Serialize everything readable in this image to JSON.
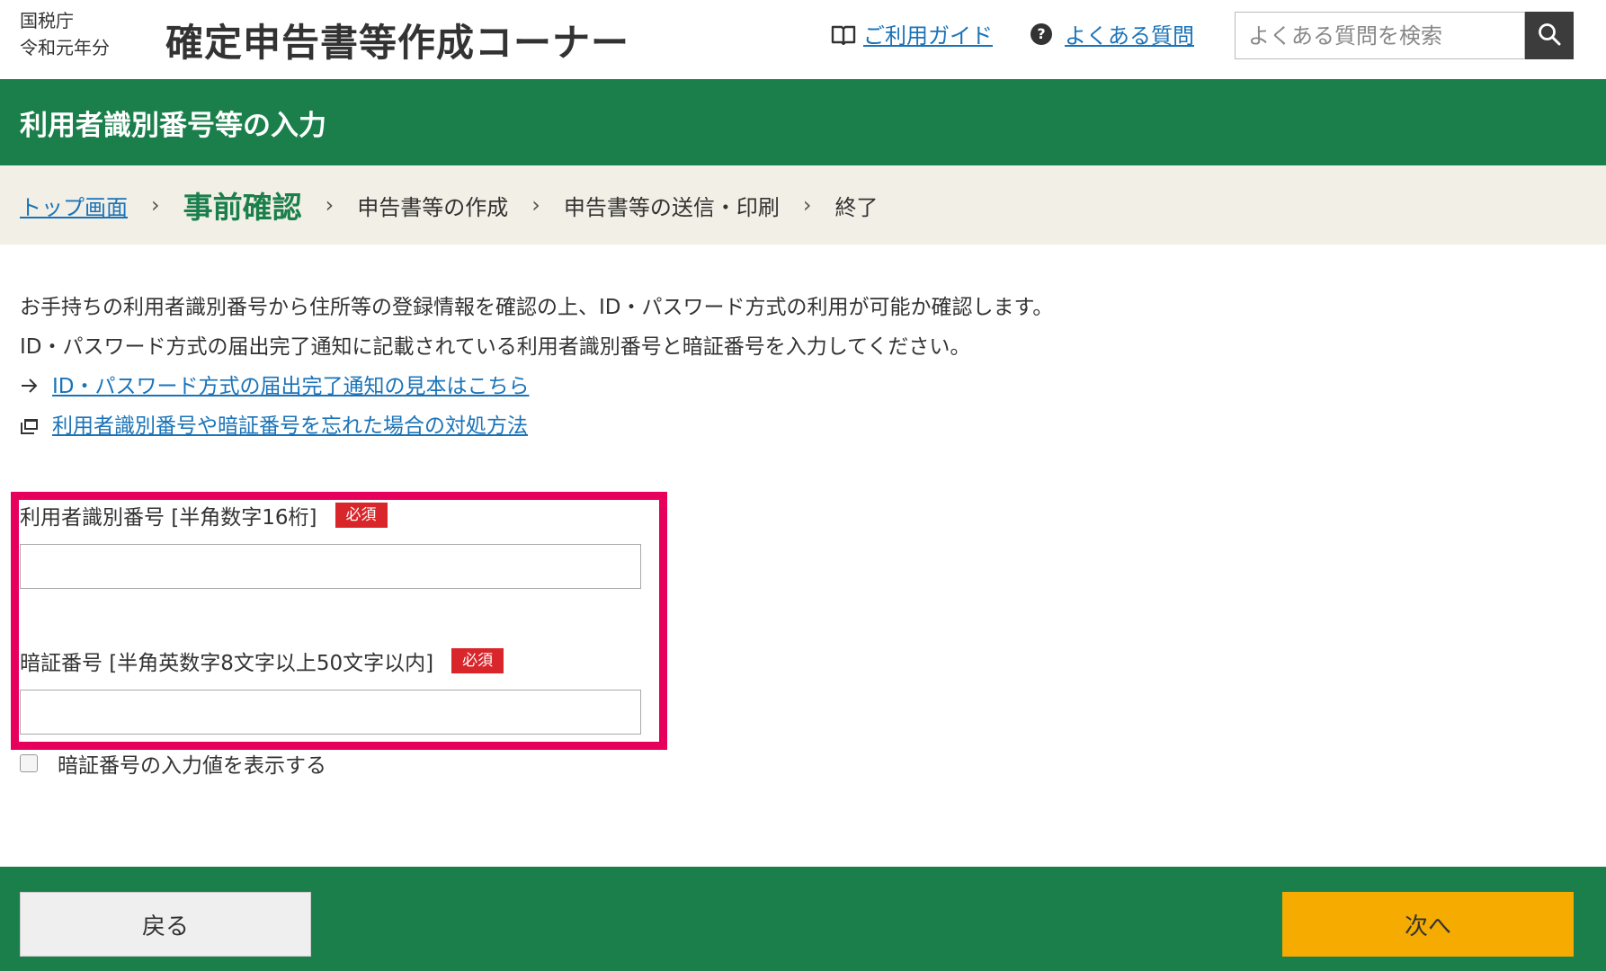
{
  "header": {
    "agency_line1": "国税庁",
    "agency_line2": "令和元年分",
    "app_title": "確定申告書等作成コーナー",
    "guide_link": "ご利用ガイド",
    "faq_link": "よくある質問",
    "search_placeholder": "よくある質問を検索",
    "guide_icon": "book-icon",
    "faq_icon": "question-icon",
    "search_icon": "search-icon"
  },
  "page_heading": "利用者識別番号等の入力",
  "breadcrumb": {
    "items": [
      "トップ画面",
      "事前確認",
      "申告書等の作成",
      "申告書等の送信・印刷",
      "終了"
    ],
    "current_index": 1,
    "separator": "›"
  },
  "intro": {
    "line1": "お手持ちの利用者識別番号から住所等の登録情報を確認の上、ID・パスワード方式の利用が可能か確認します。",
    "line2": "ID・パスワード方式の届出完了通知に記載されている利用者識別番号と暗証番号を入力してください。",
    "link1": "ID・パスワード方式の届出完了通知の見本はこちら",
    "link2": "利用者識別番号や暗証番号を忘れた場合の対処方法",
    "link1_icon": "arrow-right-icon",
    "link2_icon": "new-window-icon"
  },
  "form": {
    "user_id_label": "利用者識別番号 [半角数字16桁]",
    "user_id_value": "",
    "password_label": "暗証番号 [半角英数字8文字以上50文字以内]",
    "password_value": "",
    "required_badge": "必須",
    "show_password_label": "暗証番号の入力値を表示する",
    "show_password_checked": false
  },
  "footer": {
    "back_label": "戻る",
    "next_label": "次へ"
  },
  "colors": {
    "brand_green": "#1a7f4b",
    "breadcrumb_bg": "#f2efe6",
    "link_blue": "#1a73b8",
    "required_red": "#d8262b",
    "highlight_pink": "#e6005c",
    "next_orange": "#f5ab00"
  }
}
